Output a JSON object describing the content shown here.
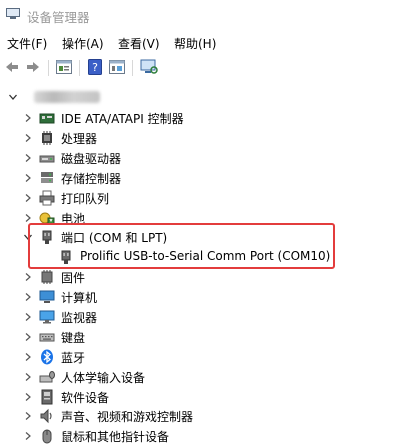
{
  "window": {
    "title": "设备管理器"
  },
  "menu": [
    "文件(F)",
    "操作(A)",
    "查看(V)",
    "帮助(H)"
  ],
  "toolbar": [
    "back-icon",
    "forward-icon",
    "properties-icon",
    "help-icon",
    "show-hidden-icon",
    "scan-hardware-icon"
  ],
  "tree": {
    "root_label": "",
    "categories": [
      {
        "label": "IDE ATA/ATAPI 控制器",
        "icon": "ide-controller-icon",
        "expanded": false
      },
      {
        "label": "处理器",
        "icon": "processor-icon",
        "expanded": false
      },
      {
        "label": "磁盘驱动器",
        "icon": "disk-drive-icon",
        "expanded": false
      },
      {
        "label": "存储控制器",
        "icon": "storage-controller-icon",
        "expanded": false
      },
      {
        "label": "打印队列",
        "icon": "print-queue-icon",
        "expanded": false
      },
      {
        "label": "电池",
        "icon": "battery-icon",
        "expanded": false
      },
      {
        "label": "端口 (COM 和 LPT)",
        "icon": "port-icon",
        "expanded": true,
        "children": [
          {
            "label": "Prolific USB-to-Serial Comm Port (COM10)",
            "icon": "serial-port-icon"
          }
        ]
      },
      {
        "label": "固件",
        "icon": "firmware-icon",
        "expanded": false
      },
      {
        "label": "计算机",
        "icon": "computer-icon",
        "expanded": false
      },
      {
        "label": "监视器",
        "icon": "monitor-icon",
        "expanded": false
      },
      {
        "label": "键盘",
        "icon": "keyboard-icon",
        "expanded": false
      },
      {
        "label": "蓝牙",
        "icon": "bluetooth-icon",
        "expanded": false
      },
      {
        "label": "人体学输入设备",
        "icon": "hid-icon",
        "expanded": false
      },
      {
        "label": "软件设备",
        "icon": "software-device-icon",
        "expanded": false
      },
      {
        "label": "声音、视频和游戏控制器",
        "icon": "sound-icon",
        "expanded": false
      },
      {
        "label": "鼠标和其他指针设备",
        "icon": "mouse-icon",
        "expanded": false
      }
    ]
  },
  "colors": {
    "highlight_border": "#e33c3c",
    "bluetooth": "#1a73e8",
    "title_text": "#9a9a9a"
  }
}
